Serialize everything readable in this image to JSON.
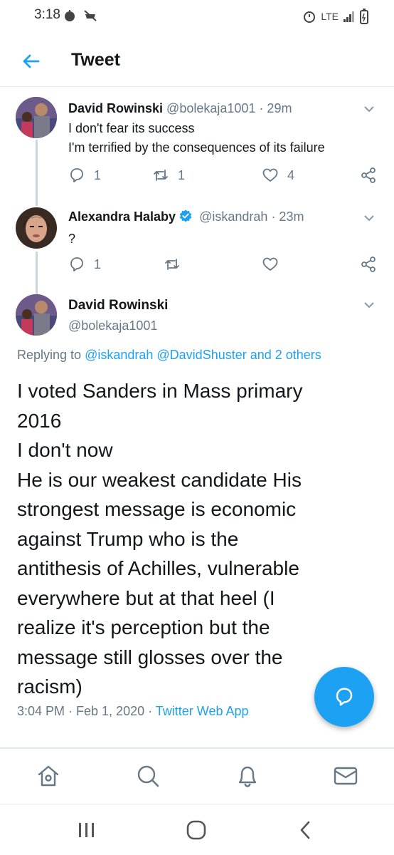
{
  "status_bar": {
    "time": "3:18",
    "network": "LTE"
  },
  "header": {
    "title": "Tweet"
  },
  "thread": [
    {
      "name": "David Rowinski",
      "handle": "@bolekaja1001",
      "time": "· 29m",
      "lines": [
        "I don't fear its success",
        "I'm terrified by the consequences of its failure"
      ],
      "replies": "1",
      "retweets": "1",
      "likes": "4"
    },
    {
      "name": "Alexandra Halaby",
      "handle": "@iskandrah",
      "time": "· 23m",
      "lines": [
        "?"
      ],
      "replies": "1",
      "retweets": "",
      "likes": ""
    }
  ],
  "main_tweet": {
    "name": "David Rowinski",
    "handle": "@bolekaja1001",
    "replying_prefix": "Replying to",
    "replying_to": "@iskandrah @DavidShuster and 2 others",
    "text_lines": [
      "I voted Sanders in Mass primary",
      "2016",
      "I don't now",
      "He is our weakest candidate His",
      "strongest message is economic",
      "against Trump who is the",
      "antithesis of Achilles, vulnerable",
      "everywhere but at that heel (I",
      "realize it's perception but the",
      "message still glosses over the",
      "racism)"
    ],
    "timestamp": "3:04 PM · Feb 1, 2020 ·",
    "source": "Twitter Web App"
  },
  "colors": {
    "accent": "#1da1f2",
    "secondary_text": "#657786",
    "divider": "#e1e8ed"
  },
  "icons": {
    "back": "arrow-left-icon",
    "fab": "compose-reply-icon",
    "nav": [
      "home-icon",
      "search-icon",
      "notifications-icon",
      "messages-icon"
    ],
    "system": [
      "recents-icon",
      "home-circle-icon",
      "back-chevron-icon"
    ]
  }
}
